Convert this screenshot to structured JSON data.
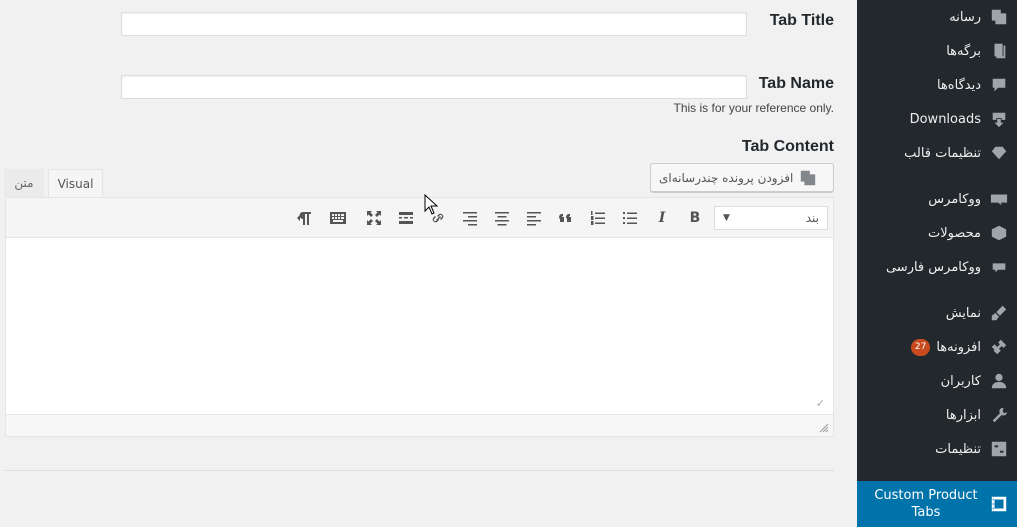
{
  "sidebar": {
    "items": [
      {
        "label": "رسانه",
        "icon": "media-icon"
      },
      {
        "label": "برگه‌ها",
        "icon": "pages-icon"
      },
      {
        "label": "دیدگاه‌ها",
        "icon": "comments-icon"
      },
      {
        "label": "Downloads",
        "icon": "downloads-icon"
      },
      {
        "label": "تنظیمات قالب",
        "icon": "diamond-icon"
      },
      {
        "label": "ووکامرس",
        "icon": "woo-icon"
      },
      {
        "label": "محصولات",
        "icon": "box-icon"
      },
      {
        "label": "ووکامرس فارسی",
        "icon": "speech-icon"
      },
      {
        "label": "نمایش",
        "icon": "brush-icon"
      },
      {
        "label": "افزونه‌ها",
        "icon": "plugin-icon",
        "badge": "27"
      },
      {
        "label": "کاربران",
        "icon": "user-icon"
      },
      {
        "label": "ابزارها",
        "icon": "wrench-icon"
      },
      {
        "label": "تنظیمات",
        "icon": "settings-icon"
      }
    ],
    "active": {
      "line1": "Custom Product",
      "line2": "Tabs",
      "icon": "film-icon"
    }
  },
  "form": {
    "tab_title_label": "Tab Title",
    "tab_title_value": "",
    "tab_name_label": "Tab Name",
    "tab_name_value": "",
    "tab_name_hint": "This is for your reference only.",
    "tab_content_label": "Tab Content",
    "add_media_label": "افزودن پرونده چندرسانه‌ای"
  },
  "editor": {
    "tab_visual": "Visual",
    "tab_text": "متن",
    "format_value": "بند",
    "format_arrow": "▼"
  },
  "colors": {
    "sidebar_bg": "#23282d",
    "active_bg": "#0073aa",
    "badge_bg": "#ca4a1f"
  }
}
